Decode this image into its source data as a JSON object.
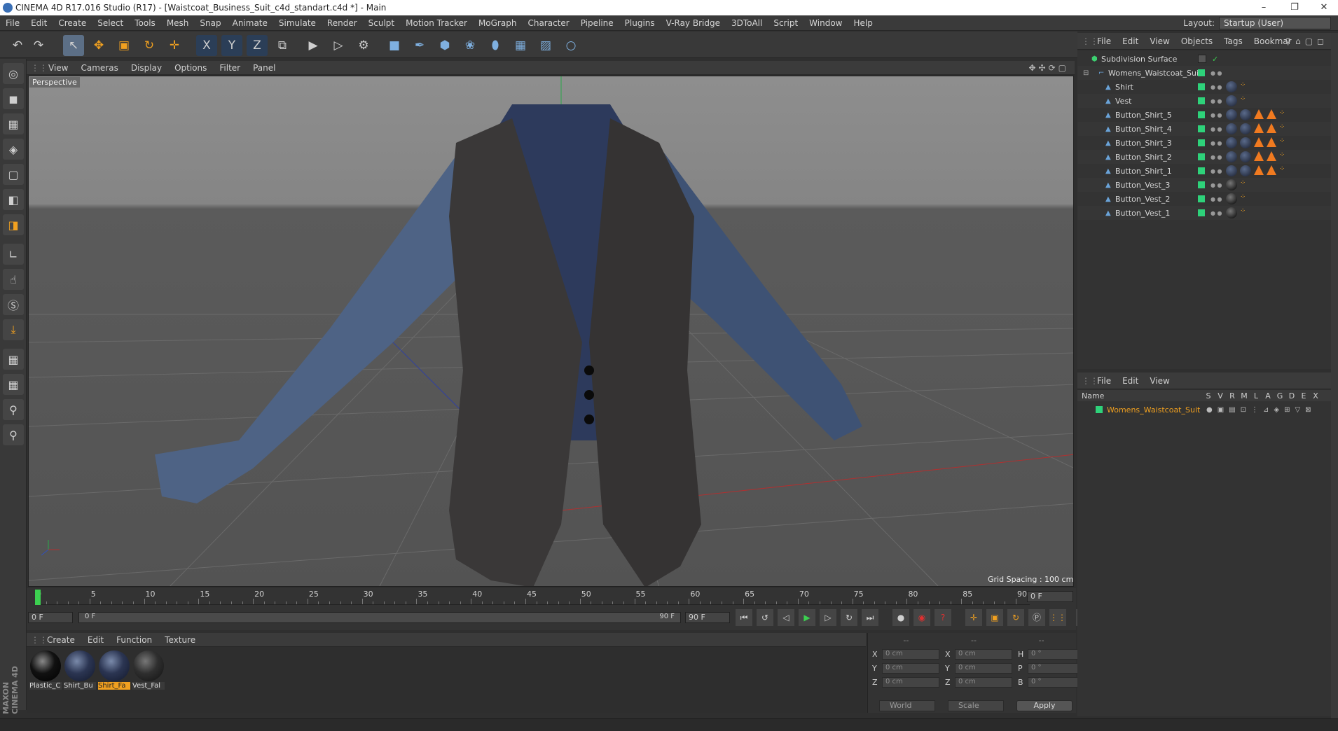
{
  "window": {
    "title": "CINEMA 4D R17.016 Studio (R17) - [Waistcoat_Business_Suit_c4d_standart.c4d *] - Main",
    "minimize": "–",
    "restore": "❐",
    "close": "✕"
  },
  "menubar": {
    "items": [
      "File",
      "Edit",
      "Create",
      "Select",
      "Tools",
      "Mesh",
      "Snap",
      "Animate",
      "Simulate",
      "Render",
      "Sculpt",
      "Motion Tracker",
      "MoGraph",
      "Character",
      "Pipeline",
      "Plugins",
      "V-Ray Bridge",
      "3DToAll",
      "Script",
      "Window",
      "Help"
    ],
    "layout_label": "Layout:",
    "layout_value": "Startup (User)"
  },
  "toolbar": {
    "buttons": [
      {
        "icon": "undo-icon",
        "glyph": "↶"
      },
      {
        "icon": "redo-icon",
        "glyph": "↷"
      },
      {
        "icon": "select-arrow-icon",
        "glyph": "↖"
      },
      {
        "icon": "move-icon",
        "glyph": "✥"
      },
      {
        "icon": "scale-icon",
        "glyph": "▣"
      },
      {
        "icon": "rotate-icon",
        "glyph": "↻"
      },
      {
        "icon": "transform-icon",
        "glyph": "✛"
      },
      {
        "icon": "x-axis-icon",
        "glyph": "X"
      },
      {
        "icon": "y-axis-icon",
        "glyph": "Y"
      },
      {
        "icon": "z-axis-icon",
        "glyph": "Z"
      },
      {
        "icon": "coordinate-system-icon",
        "glyph": "⧉"
      },
      {
        "icon": "render-view-icon",
        "glyph": "▶"
      },
      {
        "icon": "render-picture-viewer-icon",
        "glyph": "▷"
      },
      {
        "icon": "render-settings-icon",
        "glyph": "⚙"
      },
      {
        "icon": "cube-icon",
        "glyph": "■"
      },
      {
        "icon": "pen-spline-icon",
        "glyph": "✒"
      },
      {
        "icon": "subdivision-icon",
        "glyph": "⬢"
      },
      {
        "icon": "cloner-icon",
        "glyph": "❀"
      },
      {
        "icon": "deformer-icon",
        "glyph": "⬮"
      },
      {
        "icon": "floor-icon",
        "glyph": "▦"
      },
      {
        "icon": "camera-icon",
        "glyph": "▨"
      },
      {
        "icon": "light-icon",
        "glyph": "○"
      }
    ]
  },
  "lefttools": [
    "make-editable-icon",
    "model-mode-icon",
    "texture-mode-icon",
    "workplane-icon",
    "points-mode-icon",
    "edges-mode-icon",
    "polygons-mode-icon",
    "axis-icon",
    "tweak-icon",
    "solo-icon",
    "snap-icon",
    "grid-snap-icon",
    "workplane-lock-icon",
    "python-icon",
    "python2-icon"
  ],
  "viewport": {
    "menus": [
      "View",
      "Cameras",
      "Display",
      "Options",
      "Filter",
      "Panel"
    ],
    "label": "Perspective",
    "grid_spacing": "Grid Spacing : 100 cm"
  },
  "timeline": {
    "ticks": [
      "0",
      "5",
      "10",
      "15",
      "20",
      "25",
      "30",
      "35",
      "40",
      "45",
      "50",
      "55",
      "60",
      "65",
      "70",
      "75",
      "80",
      "85",
      "90"
    ],
    "current_frame": "0 F",
    "start": "0 F",
    "range_start": "0 F",
    "range_end": "90 F",
    "end": "90 F"
  },
  "materials": {
    "menus": [
      "Create",
      "Edit",
      "Function",
      "Texture"
    ],
    "items": [
      {
        "name": "Plastic_C",
        "style": "black",
        "selected": false
      },
      {
        "name": "Shirt_Bu",
        "style": "navy",
        "selected": false
      },
      {
        "name": "Shirt_Fa",
        "style": "navy",
        "selected": true
      },
      {
        "name": "Vest_Fal",
        "style": "dark",
        "selected": false
      }
    ]
  },
  "coords": {
    "headers": [
      "--",
      "--",
      "--"
    ],
    "rows": [
      {
        "a": "X",
        "av": "0 cm",
        "b": "X",
        "bv": "0 cm",
        "c": "H",
        "cv": "0 °"
      },
      {
        "a": "Y",
        "av": "0 cm",
        "b": "Y",
        "bv": "0 cm",
        "c": "P",
        "cv": "0 °"
      },
      {
        "a": "Z",
        "av": "0 cm",
        "b": "Z",
        "bv": "0 cm",
        "c": "B",
        "cv": "0 °"
      }
    ],
    "mode1": "World",
    "mode2": "Scale",
    "apply": "Apply"
  },
  "objects": {
    "menus": [
      "File",
      "Edit",
      "View",
      "Objects",
      "Tags",
      "Bookmar"
    ],
    "rows": [
      {
        "name": "Subdivision Surface",
        "indent": 0,
        "tags": []
      },
      {
        "name": "Womens_Waistcoat_Suit",
        "indent": 1,
        "tags": []
      },
      {
        "name": "Shirt",
        "indent": 2,
        "tags": [
          "navy",
          "chk",
          "org"
        ]
      },
      {
        "name": "Vest",
        "indent": 2,
        "tags": [
          "navy",
          "chk",
          "org"
        ]
      },
      {
        "name": "Button_Shirt_5",
        "indent": 2,
        "tags": [
          "navy",
          "navy",
          "tri",
          "tri",
          "chk",
          "org"
        ]
      },
      {
        "name": "Button_Shirt_4",
        "indent": 2,
        "tags": [
          "navy",
          "navy",
          "tri",
          "tri",
          "chk",
          "org"
        ]
      },
      {
        "name": "Button_Shirt_3",
        "indent": 2,
        "tags": [
          "navy",
          "navy",
          "tri",
          "tri",
          "chk",
          "org"
        ]
      },
      {
        "name": "Button_Shirt_2",
        "indent": 2,
        "tags": [
          "navy",
          "navy",
          "tri",
          "tri",
          "chk",
          "org"
        ]
      },
      {
        "name": "Button_Shirt_1",
        "indent": 2,
        "tags": [
          "navy",
          "navy",
          "tri",
          "tri",
          "chk",
          "org"
        ]
      },
      {
        "name": "Button_Vest_3",
        "indent": 2,
        "tags": [
          "blk",
          "chk",
          "org"
        ]
      },
      {
        "name": "Button_Vest_2",
        "indent": 2,
        "tags": [
          "blk",
          "chk",
          "org"
        ]
      },
      {
        "name": "Button_Vest_1",
        "indent": 2,
        "tags": [
          "blk",
          "chk",
          "org"
        ]
      }
    ]
  },
  "layers": {
    "menus": [
      "File",
      "Edit",
      "View"
    ],
    "name_header": "Name",
    "cols": [
      "S",
      "V",
      "R",
      "M",
      "L",
      "A",
      "G",
      "D",
      "E",
      "X"
    ],
    "rows": [
      {
        "name": "Womens_Waistcoat_Suit",
        "color": "#2ed27a"
      }
    ]
  },
  "colors": {
    "accent": "#f0a020",
    "layer_green": "#2ed27a",
    "selected_tool": "#5c6f86"
  }
}
